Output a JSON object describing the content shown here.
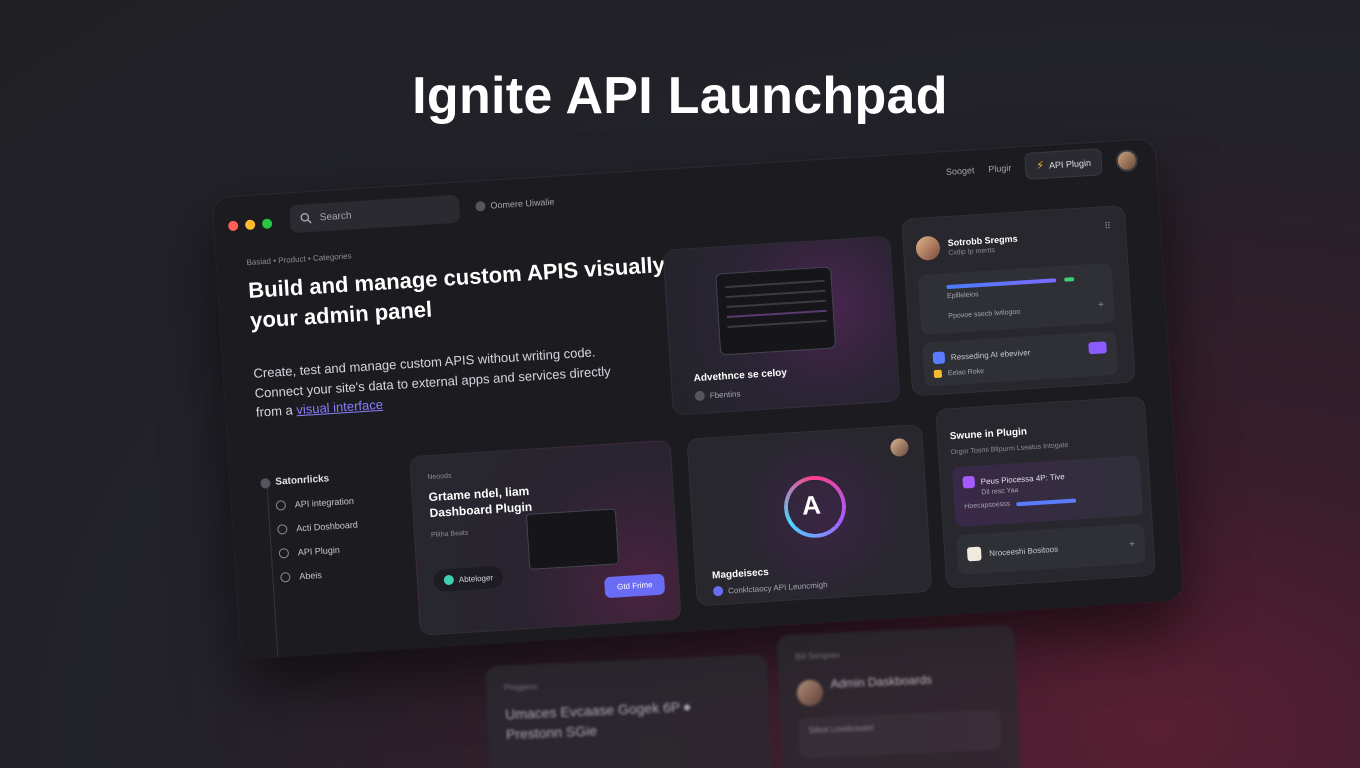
{
  "hero": {
    "title": "Ignite API Launchpad"
  },
  "window": {
    "search_placeholder": "Search",
    "top_link": "Oomere Uiwalie",
    "top_right": {
      "item1": "Sooget",
      "item2": "Plugir",
      "chip": "API Plugin"
    },
    "breadcrumb": "Basiad  •  Product  •  Categories",
    "headline": "Build and manage custom APIS visually from from your admin panel",
    "subtext_main": "Create, test and manage custom APIS without writing code. Connect your site's data to external apps and services directly from a ",
    "subtext_link": "visual interface",
    "shortcuts_title": "Satonrlicks",
    "side_items": [
      "API integration",
      "Acti Doshboard",
      "API Plugin",
      "Abeis"
    ]
  },
  "cards": {
    "neon": {
      "label": "Advethnce se celoy",
      "sub": "Fbentins"
    },
    "users": {
      "name": "Sotrobb Sregms",
      "sub": "Cxtlip Ip mertts",
      "row1": "Epllleleios",
      "row2": "Ppovoe ssecb Iwtlogoo",
      "row3": "Resseding AI ebeviver",
      "row4": "Eelao Roke"
    },
    "dash": {
      "kicker": "Neoods",
      "title": "Grtame ndel, liam Dashboard Plugin",
      "sub": "Plitha Beats",
      "btn1": "Abteloger",
      "btn2": "Gtd Frime"
    },
    "logo": {
      "title": "Magdeisecs",
      "sub": "Conklctaocy API Leuncmigh"
    },
    "plugin": {
      "title": "Swune in Plugin",
      "sub": "Orgor Tosmi Bltpurm Lseatus Intogate",
      "box1_line1": "Peus Piocessa 4P: Tive",
      "box1_line2": "Dil resc Yaa",
      "box1_line3": "Hoecapsoesss",
      "box2": "Nroceeshi Bositoos"
    }
  },
  "ghosts": {
    "left": {
      "kicker": "Pinggeos",
      "title": "Umaces Evcaase Gogek 6P ● Prestonn SGie"
    },
    "right": {
      "kicker": "Bili Sengnes",
      "name": "Admin Daskboards",
      "box": "Sifest Lovelcouast"
    }
  }
}
